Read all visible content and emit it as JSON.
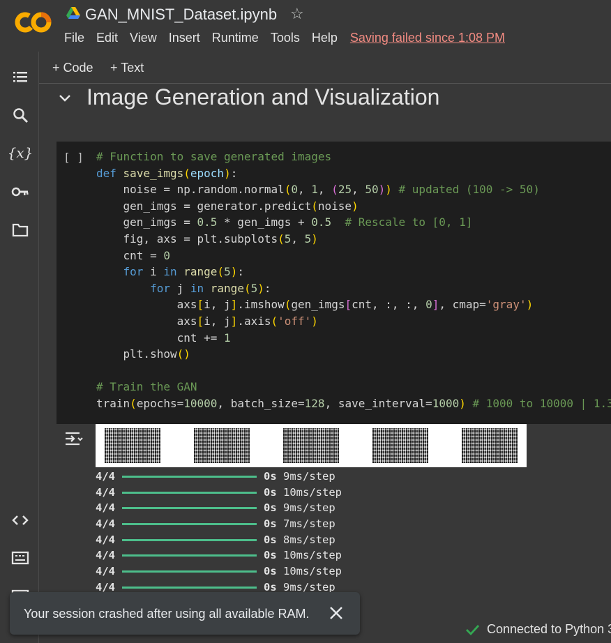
{
  "header": {
    "title": "GAN_MNIST_Dataset.ipynb",
    "star_icon": "star-outline-icon",
    "menu": [
      "File",
      "Edit",
      "View",
      "Insert",
      "Runtime",
      "Tools",
      "Help"
    ],
    "save_status": "Saving failed since 1:08 PM"
  },
  "toolbar": {
    "code_label": "+ Code",
    "text_label": "+ Text"
  },
  "rail_icons": [
    "toc-icon",
    "search-icon",
    "variables-icon",
    "key-icon",
    "folder-icon",
    "code-snippets-icon",
    "command-palette-icon"
  ],
  "section": {
    "title": "Image Generation and Visualization"
  },
  "cell": {
    "run_indicator": "[ ]",
    "code_lines": [
      "# Function to save generated images",
      "def save_imgs(epoch):",
      "    noise = np.random.normal(0, 1, (25, 50)) # updated (100 -> 50)",
      "    gen_imgs = generator.predict(noise)",
      "    gen_imgs = 0.5 * gen_imgs + 0.5  # Rescale to [0, 1]",
      "    fig, axs = plt.subplots(5, 5)",
      "    cnt = 0",
      "    for i in range(5):",
      "        for j in range(5):",
      "            axs[i, j].imshow(gen_imgs[cnt, :, :, 0], cmap='gray')",
      "            axs[i, j].axis('off')",
      "            cnt += 1",
      "    plt.show()",
      "",
      "# Train the GAN",
      "train(epochs=10000, batch_size=128, save_interval=1000) # 1000 to 10000 | 1.3"
    ]
  },
  "output": {
    "log": [
      {
        "steps": "4/4",
        "time": "0s",
        "rate": "9ms/step"
      },
      {
        "steps": "4/4",
        "time": "0s",
        "rate": "10ms/step"
      },
      {
        "steps": "4/4",
        "time": "0s",
        "rate": "9ms/step"
      },
      {
        "steps": "4/4",
        "time": "0s",
        "rate": "7ms/step"
      },
      {
        "steps": "4/4",
        "time": "0s",
        "rate": "8ms/step"
      },
      {
        "steps": "4/4",
        "time": "0s",
        "rate": "10ms/step"
      },
      {
        "steps": "4/4",
        "time": "0s",
        "rate": "10ms/step"
      },
      {
        "steps": "4/4",
        "time": "0s",
        "rate": "9ms/step"
      }
    ]
  },
  "toast": {
    "message": "Your session crashed after using all available RAM."
  },
  "status": {
    "text": "Connected to Python 3"
  },
  "colors": {
    "progress": "#4dbe8b",
    "warning": "#f28b82",
    "logo_orange": "#f9ab00",
    "logo_dark_orange": "#e8710a",
    "connected": "#34a853"
  }
}
